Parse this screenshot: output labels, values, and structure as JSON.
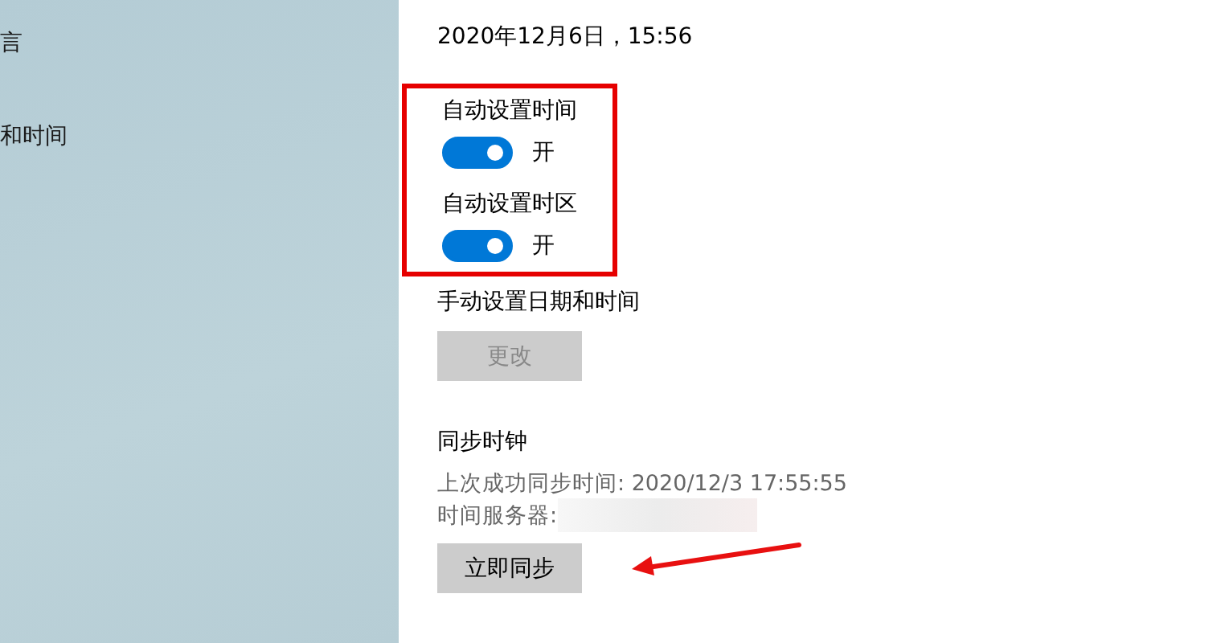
{
  "sidebar": {
    "items": [
      {
        "label": "言"
      },
      {
        "label": "和时间"
      }
    ]
  },
  "current_time": "2020年12月6日，15:56",
  "auto_settings": {
    "highlighted": true,
    "toggles": [
      {
        "label": "自动设置时间",
        "on": true,
        "state_text": "开"
      },
      {
        "label": "自动设置时区",
        "on": true,
        "state_text": "开"
      }
    ]
  },
  "manual": {
    "label": "手动设置日期和时间",
    "button": {
      "label": "更改",
      "disabled": true
    }
  },
  "sync": {
    "heading": "同步时钟",
    "last_sync": "上次成功同步时间: 2020/12/3 17:55:55",
    "server_label": "时间服务器:",
    "server_value_redacted": true,
    "button": {
      "label": "立即同步",
      "disabled": false
    },
    "pointer_arrow": true
  }
}
